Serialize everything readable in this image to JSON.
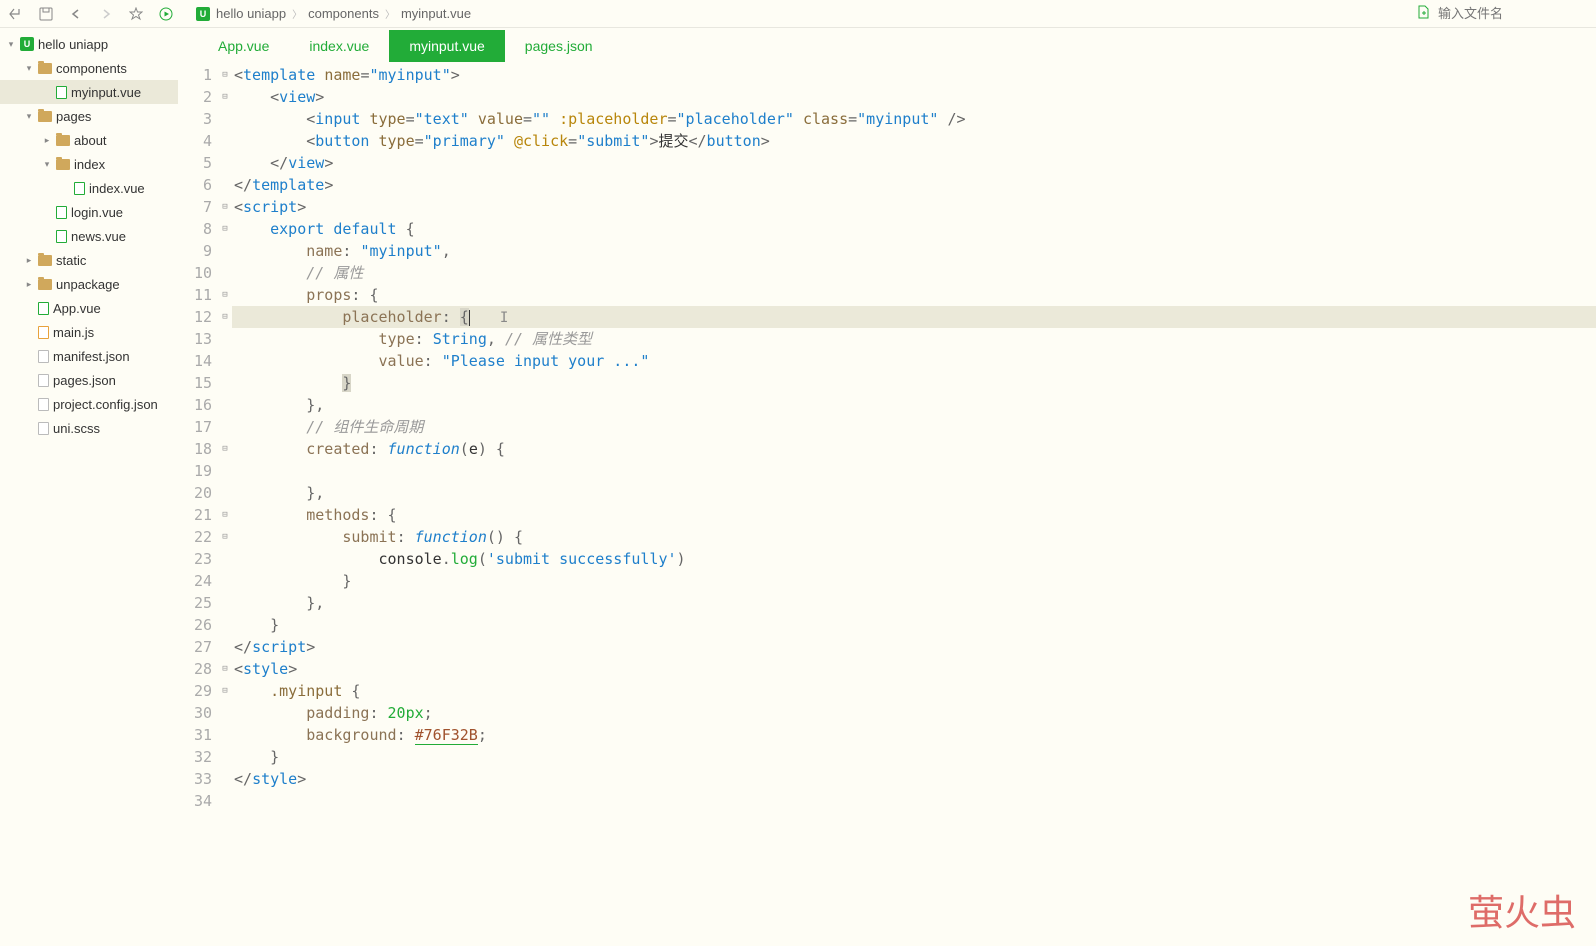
{
  "toolbar": {
    "breadcrumb": [
      "hello uniapp",
      "components",
      "myinput.vue"
    ],
    "search_placeholder": "输入文件名"
  },
  "sidebar": {
    "project": "hello uniapp",
    "tree": [
      {
        "label": "components",
        "depth": 1,
        "type": "folder",
        "open": true
      },
      {
        "label": "myinput.vue",
        "depth": 2,
        "type": "vue",
        "active": true
      },
      {
        "label": "pages",
        "depth": 1,
        "type": "folder",
        "open": true
      },
      {
        "label": "about",
        "depth": 2,
        "type": "folder",
        "open": false,
        "chev": "right"
      },
      {
        "label": "index",
        "depth": 2,
        "type": "folder",
        "open": true
      },
      {
        "label": "index.vue",
        "depth": 3,
        "type": "vue"
      },
      {
        "label": "login.vue",
        "depth": 2,
        "type": "vue"
      },
      {
        "label": "news.vue",
        "depth": 2,
        "type": "vue"
      },
      {
        "label": "static",
        "depth": 1,
        "type": "folder",
        "open": false,
        "chev": "right"
      },
      {
        "label": "unpackage",
        "depth": 1,
        "type": "folder",
        "open": false,
        "chev": "right"
      },
      {
        "label": "App.vue",
        "depth": 1,
        "type": "vue"
      },
      {
        "label": "main.js",
        "depth": 1,
        "type": "js"
      },
      {
        "label": "manifest.json",
        "depth": 1,
        "type": "json"
      },
      {
        "label": "pages.json",
        "depth": 1,
        "type": "json"
      },
      {
        "label": "project.config.json",
        "depth": 1,
        "type": "json"
      },
      {
        "label": "uni.scss",
        "depth": 1,
        "type": "css"
      }
    ]
  },
  "tabs": [
    {
      "label": "App.vue",
      "active": false
    },
    {
      "label": "index.vue",
      "active": false
    },
    {
      "label": "myinput.vue",
      "active": true
    },
    {
      "label": "pages.json",
      "active": false
    }
  ],
  "code": {
    "current_line": 12,
    "lines": [
      {
        "n": 1,
        "fold": "⊟",
        "html": "<span class='punct'>&lt;</span><span class='tag'>template</span> <span class='attr'>name</span><span class='punct'>=</span><span class='str'>\"myinput\"</span><span class='punct'>&gt;</span>"
      },
      {
        "n": 2,
        "fold": "⊟",
        "html": "    <span class='punct'>&lt;</span><span class='tag'>view</span><span class='punct'>&gt;</span>"
      },
      {
        "n": 3,
        "fold": "",
        "html": "        <span class='punct'>&lt;</span><span class='tag'>input</span> <span class='attr'>type</span><span class='punct'>=</span><span class='str'>\"text\"</span> <span class='attr'>value</span><span class='punct'>=</span><span class='str'>\"\"</span> <span class='attr2'>:placeholder</span><span class='punct'>=</span><span class='str'>\"placeholder\"</span> <span class='attr'>class</span><span class='punct'>=</span><span class='str'>\"myinput\"</span> <span class='punct'>/&gt;</span>"
      },
      {
        "n": 4,
        "fold": "",
        "html": "        <span class='punct'>&lt;</span><span class='tag'>button</span> <span class='attr'>type</span><span class='punct'>=</span><span class='str'>\"primary\"</span> <span class='attr2'>@click</span><span class='punct'>=</span><span class='str'>\"submit\"</span><span class='punct'>&gt;</span>提交<span class='punct'>&lt;/</span><span class='tag'>button</span><span class='punct'>&gt;</span>"
      },
      {
        "n": 5,
        "fold": "",
        "html": "    <span class='punct'>&lt;/</span><span class='tag'>view</span><span class='punct'>&gt;</span>"
      },
      {
        "n": 6,
        "fold": "",
        "html": "<span class='punct'>&lt;/</span><span class='tag'>template</span><span class='punct'>&gt;</span>"
      },
      {
        "n": 7,
        "fold": "⊟",
        "html": "<span class='punct'>&lt;</span><span class='tag'>script</span><span class='punct'>&gt;</span>"
      },
      {
        "n": 8,
        "fold": "⊟",
        "html": "    <span class='kw'>export</span> <span class='kw'>default</span> <span class='punct'>{</span>"
      },
      {
        "n": 9,
        "fold": "",
        "html": "        <span class='prop'>name</span><span class='punct'>:</span> <span class='str'>\"myinput\"</span><span class='punct'>,</span>"
      },
      {
        "n": 10,
        "fold": "",
        "html": "        <span class='comment'>// 属性</span>"
      },
      {
        "n": 11,
        "fold": "⊟",
        "html": "        <span class='prop'>props</span><span class='punct'>:</span> <span class='punct'>{</span>"
      },
      {
        "n": 12,
        "fold": "⊟",
        "html": "            <span class='prop'>placeholder</span><span class='punct'>:</span> <span class='punct' style='background:#d8d6c8'>{</span><span class='cursor-caret'></span><span class='text-cursor'>I</span>"
      },
      {
        "n": 13,
        "fold": "",
        "html": "                <span class='prop'>type</span><span class='punct'>:</span> <span class='kw'>String</span><span class='punct'>,</span> <span class='comment'>// 属性类型</span>"
      },
      {
        "n": 14,
        "fold": "",
        "html": "                <span class='prop'>value</span><span class='punct'>:</span> <span class='str'>\"Please input your ...\"</span>"
      },
      {
        "n": 15,
        "fold": "",
        "html": "            <span class='punct' style='background:#d8d6c8'>}</span>"
      },
      {
        "n": 16,
        "fold": "",
        "html": "        <span class='punct'>},</span>"
      },
      {
        "n": 17,
        "fold": "",
        "html": "        <span class='comment'>// 组件生命周期</span>"
      },
      {
        "n": 18,
        "fold": "⊟",
        "html": "        <span class='prop'>created</span><span class='punct'>:</span> <span class='kw ital'>function</span><span class='punct'>(</span>e<span class='punct'>)</span> <span class='punct'>{</span>"
      },
      {
        "n": 19,
        "fold": "",
        "html": ""
      },
      {
        "n": 20,
        "fold": "",
        "html": "        <span class='punct'>},</span>"
      },
      {
        "n": 21,
        "fold": "⊟",
        "html": "        <span class='prop'>methods</span><span class='punct'>:</span> <span class='punct'>{</span>"
      },
      {
        "n": 22,
        "fold": "⊟",
        "html": "            <span class='prop'>submit</span><span class='punct'>:</span> <span class='kw ital'>function</span><span class='punct'>()</span> <span class='punct'>{</span>"
      },
      {
        "n": 23,
        "fold": "",
        "html": "                console<span class='punct'>.</span><span class='fn'>log</span><span class='punct'>(</span><span class='str'>'submit successfully'</span><span class='punct'>)</span>"
      },
      {
        "n": 24,
        "fold": "",
        "html": "            <span class='punct'>}</span>"
      },
      {
        "n": 25,
        "fold": "",
        "html": "        <span class='punct'>},</span>"
      },
      {
        "n": 26,
        "fold": "",
        "html": "    <span class='punct'>}</span>"
      },
      {
        "n": 27,
        "fold": "",
        "html": "<span class='punct'>&lt;/</span><span class='tag'>script</span><span class='punct'>&gt;</span>"
      },
      {
        "n": 28,
        "fold": "⊟",
        "html": "<span class='punct'>&lt;</span><span class='tag'>style</span><span class='punct'>&gt;</span>"
      },
      {
        "n": 29,
        "fold": "⊟",
        "html": "    <span class='attr'>.myinput</span> <span class='punct'>{</span>"
      },
      {
        "n": 30,
        "fold": "",
        "html": "        <span class='prop'>padding</span><span class='punct'>:</span> <span class='num'>20px</span><span class='punct'>;</span>"
      },
      {
        "n": 31,
        "fold": "",
        "html": "        <span class='prop'>background</span><span class='punct'>:</span> <span class='color-val'>#76F32B</span><span class='punct'>;</span>"
      },
      {
        "n": 32,
        "fold": "",
        "html": "    <span class='punct'>}</span>"
      },
      {
        "n": 33,
        "fold": "",
        "html": "<span class='punct'>&lt;/</span><span class='tag'>style</span><span class='punct'>&gt;</span>"
      },
      {
        "n": 34,
        "fold": "",
        "html": ""
      }
    ]
  },
  "watermark": "萤火虫"
}
